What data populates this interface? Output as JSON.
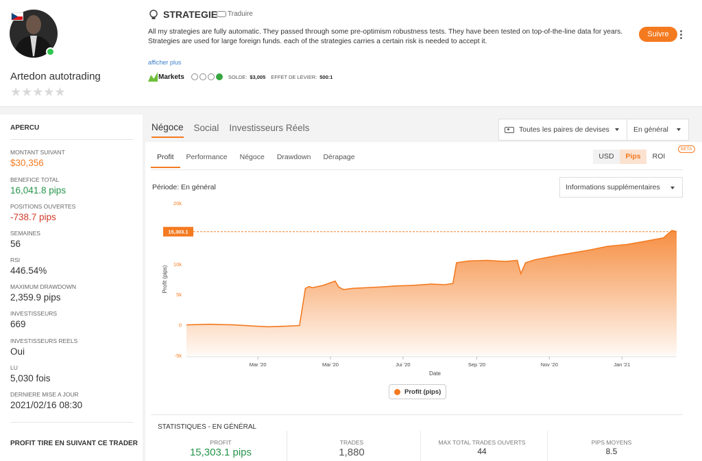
{
  "colors": {
    "accent": "#f47a20",
    "positive": "#26944a",
    "negative": "#d13b2a"
  },
  "profile": {
    "name": "Artedon autotrading",
    "rating_stars": "★★★★★",
    "rating_value": 0,
    "online": true,
    "flag": "czech-republic"
  },
  "strategy": {
    "title": "STRATEGIE",
    "translate": "Traduire",
    "description": "All my strategies are fully automatic. They passed through some pre-optimism robustness tests. They have been tested on top-of-the-line data for years.",
    "description2": "Strategies are used for large foreign funds. each of the strategies carries a certain risk is needed to accept it.",
    "show_more": "afficher plus",
    "broker": "Markets",
    "balance_label": "SOLDE:",
    "balance": "$3,005",
    "leverage_label": "EFFET DE LEVIER:",
    "leverage": "500:1",
    "follow": "Suivre"
  },
  "sidebar": {
    "title": "APERCU",
    "stats": [
      {
        "label": "MONTANT SUIVANT",
        "value": "$30,356",
        "tone": "orange"
      },
      {
        "label": "BENEFICE TOTAL",
        "value": "16,041.8 pips",
        "tone": "green"
      },
      {
        "label": "POSITIONS OUVERTES",
        "value": "-738.7 pips",
        "tone": "red"
      },
      {
        "label": "SEMAINES",
        "value": "56",
        "tone": ""
      },
      {
        "label": "RSI",
        "value": "446.54%",
        "tone": ""
      },
      {
        "label": "MAXIMUM DRAWDOWN",
        "value": "2,359.9 pips",
        "tone": ""
      },
      {
        "label": "INVESTISSEURS",
        "value": "669",
        "tone": ""
      },
      {
        "label": "INVESTISSEURS REELS",
        "value": "Oui",
        "tone": ""
      },
      {
        "label": "LU",
        "value": "5,030 fois",
        "tone": ""
      },
      {
        "label": "DERNIERE MISE A JOUR",
        "value": "2021/02/16 08:30",
        "tone": ""
      }
    ],
    "bottom_title": "PROFIT TIRE EN SUIVANT CE TRADER"
  },
  "main": {
    "tabs": [
      "Négoce",
      "Social",
      "Investisseurs Réels"
    ],
    "pairs_dropdown": "Toutes les paires de devises",
    "period_dropdown": "En général",
    "subtabs": [
      "Profit",
      "Performance",
      "Négoce",
      "Drawdown",
      "Dérapage"
    ],
    "units": [
      "USD",
      "Pips",
      "ROI"
    ],
    "beta": "BETA",
    "period_label": "Période:",
    "period_value": "En général",
    "info_dropdown": "Informations supplémentaires",
    "legend": "Profit (pips)"
  },
  "stats": {
    "title": "STATISTIQUES - EN GÉNÉRAL",
    "cells": [
      {
        "label": "PROFIT",
        "value": "15,303.1 pips"
      },
      {
        "label": "TRADES",
        "value": "1,880"
      },
      {
        "label": "MAX TOTAL TRADES OUVERTS",
        "value": "44"
      },
      {
        "label": "PIPS MOYENS",
        "value": "8.5"
      }
    ]
  },
  "chart_data": {
    "type": "area",
    "xlabel": "Date",
    "ylabel": "Profit (pips)",
    "ylim": [
      -5000,
      20000
    ],
    "yticks": [
      -5000,
      0,
      5000,
      10000,
      15000,
      20000
    ],
    "ytick_labels": [
      "-5k",
      "0",
      "5k",
      "10k",
      "15k",
      "20k"
    ],
    "xticks": [
      "Mar '20",
      "Mai '20",
      "Jui '20",
      "Sep '20",
      "Nov '20",
      "Jan '21"
    ],
    "last_value_label": "15,303.1",
    "last_value": 15303.1,
    "series": [
      {
        "name": "Profit (pips)",
        "x": [
          "2020-01-01",
          "2020-01-20",
          "2020-02-10",
          "2020-02-28",
          "2020-03-10",
          "2020-03-25",
          "2020-04-05",
          "2020-04-10",
          "2020-04-13",
          "2020-04-16",
          "2020-04-25",
          "2020-05-05",
          "2020-05-08",
          "2020-05-12",
          "2020-05-20",
          "2020-06-10",
          "2020-06-25",
          "2020-07-10",
          "2020-07-25",
          "2020-08-05",
          "2020-08-12",
          "2020-08-15",
          "2020-08-25",
          "2020-09-10",
          "2020-09-25",
          "2020-10-05",
          "2020-10-08",
          "2020-10-12",
          "2020-10-20",
          "2020-11-05",
          "2020-11-20",
          "2020-12-05",
          "2020-12-20",
          "2021-01-05",
          "2021-01-20",
          "2021-02-05",
          "2021-02-12",
          "2021-02-16"
        ],
        "y": [
          0,
          100,
          0,
          -200,
          -300,
          -200,
          -100,
          6000,
          6300,
          6100,
          6500,
          7200,
          6200,
          5800,
          6000,
          6200,
          6400,
          6500,
          6700,
          6600,
          6800,
          10200,
          10500,
          10600,
          10400,
          10600,
          8400,
          10200,
          10700,
          11300,
          11800,
          12300,
          12900,
          13200,
          13700,
          14300,
          15500,
          15303.1
        ]
      }
    ]
  }
}
